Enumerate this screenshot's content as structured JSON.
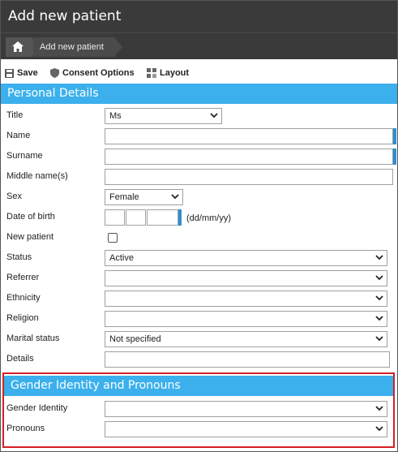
{
  "window": {
    "title": "Add new patient"
  },
  "breadcrumb": {
    "home_icon": "home-icon",
    "current": "Add new patient"
  },
  "toolbar": {
    "save_label": "Save",
    "consent_label": "Consent Options",
    "layout_label": "Layout"
  },
  "sections": {
    "personal": "Personal Details",
    "gender": "Gender Identity and Pronouns"
  },
  "fields": {
    "title": {
      "label": "Title",
      "value": "Ms"
    },
    "name": {
      "label": "Name",
      "value": ""
    },
    "surname": {
      "label": "Surname",
      "value": ""
    },
    "middle": {
      "label": "Middle name(s)",
      "value": ""
    },
    "sex": {
      "label": "Sex",
      "value": "Female"
    },
    "dob": {
      "label": "Date of birth",
      "hint": "(dd/mm/yy)"
    },
    "new_patient": {
      "label": "New patient",
      "checked": false
    },
    "status": {
      "label": "Status",
      "value": "Active"
    },
    "referrer": {
      "label": "Referrer",
      "value": ""
    },
    "ethnicity": {
      "label": "Ethnicity",
      "value": ""
    },
    "religion": {
      "label": "Religion",
      "value": ""
    },
    "marital": {
      "label": "Marital status",
      "value": "Not specified"
    },
    "details": {
      "label": "Details",
      "value": ""
    },
    "gender_identity": {
      "label": "Gender Identity",
      "value": ""
    },
    "pronouns": {
      "label": "Pronouns",
      "value": ""
    }
  },
  "colors": {
    "header_bg": "#3a3a3a",
    "section_bg": "#3bb0ec",
    "required_marker": "#2c8fd0",
    "highlight": "#d61f26"
  }
}
